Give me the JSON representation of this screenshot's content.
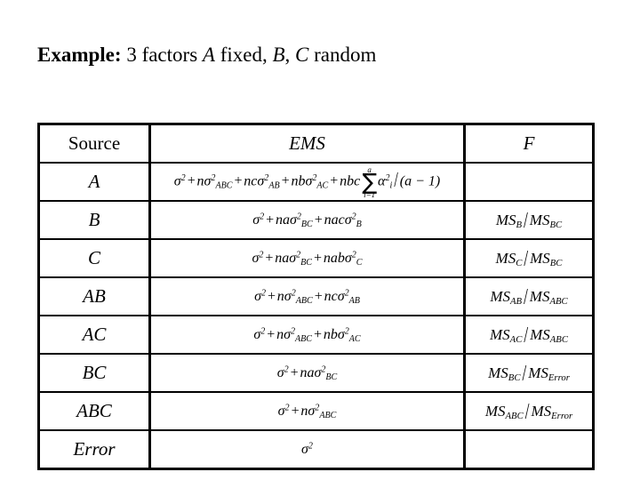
{
  "slide": {
    "title": {
      "lead": "Example:",
      "rest_1": " 3 factors ",
      "var_a": "A",
      "rest_2": " fixed, ",
      "var_b": "B",
      "rest_3": ", ",
      "var_c": "C",
      "rest_4": " random"
    },
    "background_color": "#ffffff",
    "text_color": "#000000"
  },
  "table": {
    "name": "expected-mean-squares-table",
    "headers": {
      "source": "Source",
      "ems": "EMS",
      "f": "F"
    },
    "rows": [
      {
        "source": "A",
        "ems_text": "σ² + nσ²ABC + ncσ²AB + nbσ²AC + nbc Σ α²i / (a − 1)",
        "f_text": ""
      },
      {
        "source": "B",
        "ems_text": "σ² + naσ²BC + nacσ²B",
        "f_text": "MSB / MSBC"
      },
      {
        "source": "C",
        "ems_text": "σ² + naσ²BC + nabσ²C",
        "f_text": "MSC / MSBC"
      },
      {
        "source": "AB",
        "ems_text": "σ² + nσ²ABC + ncσ²AB",
        "f_text": "MSAB / MSABC"
      },
      {
        "source": "AC",
        "ems_text": "σ² + nσ²ABC + nbσ²AC",
        "f_text": "MSAC / MSABC"
      },
      {
        "source": "BC",
        "ems_text": "σ² + naσ²BC",
        "f_text": "MSBC / MSError"
      },
      {
        "source": "ABC",
        "ems_text": "σ² + nσ²ABC",
        "f_text": "MSABC / MSError"
      },
      {
        "source": "Error",
        "ems_text": "σ²",
        "f_text": ""
      }
    ],
    "symbols": {
      "sigma": "σ",
      "alpha": "α",
      "sum": "∑",
      "sum_upper": "a",
      "sum_lower": "i=1",
      "divisor": "(a − 1)",
      "minus": "−",
      "plus": "+",
      "slash": "/",
      "ms": "MS",
      "sub_abc": "ABC",
      "sub_ab": "AB",
      "sub_ac": "AC",
      "sub_bc": "BC",
      "sub_a": "A",
      "sub_b": "B",
      "sub_c": "C",
      "sub_i": "i",
      "sub_error": "Error",
      "coef_n": "n",
      "coef_na": "na",
      "coef_nc": "nc",
      "coef_nb": "nb",
      "coef_nac": "nac",
      "coef_nab": "nab",
      "coef_nbc": "nbc",
      "sq": "2"
    }
  }
}
